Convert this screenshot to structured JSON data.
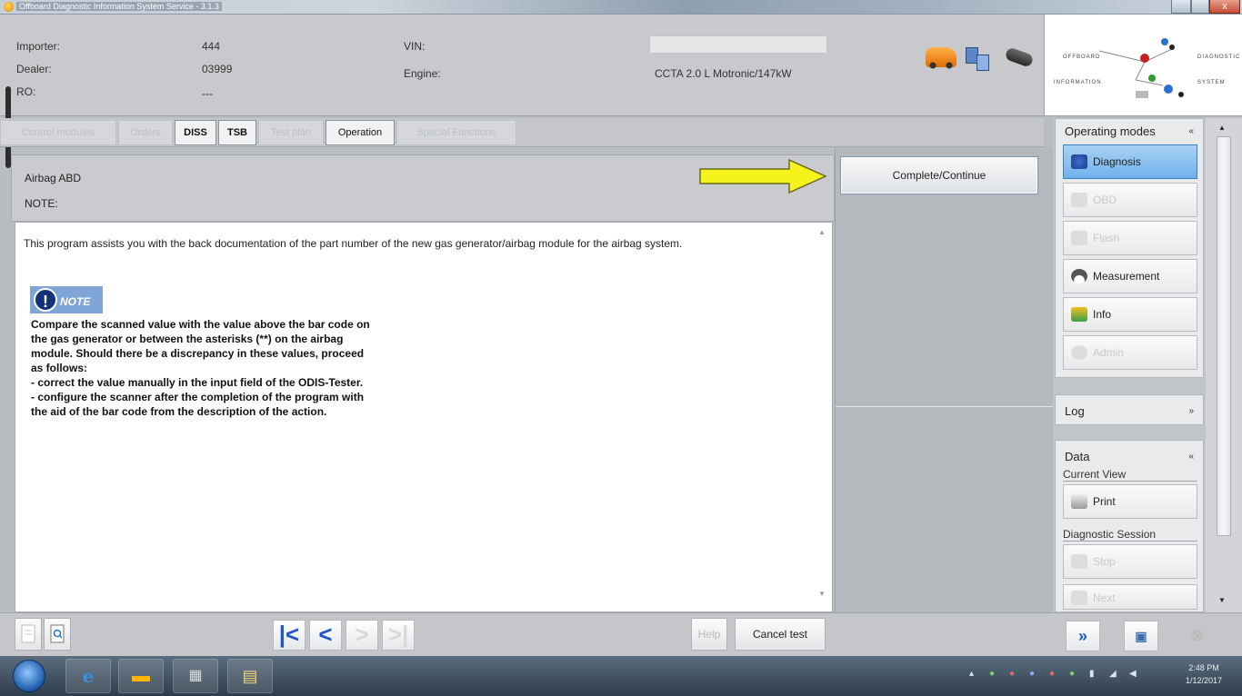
{
  "window": {
    "title": "Offboard Diagnostic Information System Service - 3.1.3",
    "close_glyph": "x"
  },
  "header": {
    "importer_label": "Importer:",
    "importer_value": "444",
    "dealer_label": "Dealer:",
    "dealer_value": "03999",
    "ro_label": "RO:",
    "ro_value": "---",
    "vin_label": "VIN:",
    "vin_value": "",
    "engine_label": "Engine:",
    "engine_value": "CCTA 2.0 L Motronic/147kW"
  },
  "logo": {
    "word1": "OFFBOARD",
    "word2": "DIAGNOSTIC",
    "word3": "INFORMATION",
    "word4": "SYSTEM"
  },
  "tabs": [
    {
      "label": "Control modules",
      "active": false
    },
    {
      "label": "Orders",
      "active": false
    },
    {
      "label": "DISS",
      "active": true
    },
    {
      "label": "TSB",
      "active": true
    },
    {
      "label": "Test plan",
      "active": false
    },
    {
      "label": "Operation",
      "active": true
    },
    {
      "label": "Special Functions",
      "active": false
    }
  ],
  "info_panel": {
    "title": "Airbag ABD",
    "note_label": "NOTE:"
  },
  "complete_button": "Complete/Continue",
  "document": {
    "intro": "This program assists you with the back documentation of the part number of the new gas generator/airbag module for the airbag system.",
    "note_badge": "NOTE",
    "note_lines": [
      "Compare the scanned value with the value above the bar code on",
      "the gas generator or between the asterisks (**) on the airbag",
      "module. Should there be a discrepancy in these values, proceed",
      "as follows:",
      "- correct the value manually in the input field of the ODIS-Tester.",
      "- configure the scanner after the completion of the program with",
      "the aid of the bar code from the description of the action."
    ]
  },
  "bottom_toolbar": {
    "help_label": "Help",
    "cancel_label": "Cancel test"
  },
  "right_panel": {
    "operating_modes": {
      "title": "Operating modes",
      "toggle": "«",
      "buttons": [
        {
          "label": "Diagnosis",
          "state": "active"
        },
        {
          "label": "OBD",
          "state": "disabled"
        },
        {
          "label": "Flash",
          "state": "disabled"
        },
        {
          "label": "Measurement",
          "state": "enabled"
        },
        {
          "label": "Info",
          "state": "enabled"
        },
        {
          "label": "Admin",
          "state": "disabled"
        }
      ]
    },
    "log": {
      "title": "Log",
      "toggle": "»"
    },
    "data": {
      "title": "Data",
      "toggle": "«",
      "current_view": "Current View",
      "print_label": "Print",
      "diagnostic_session": "Diagnostic Session",
      "stop_label": "Stop",
      "next_label": "Next"
    }
  },
  "taskbar": {
    "time": "2:48 PM",
    "date": "1/12/2017"
  },
  "colors": {
    "accent_blue": "#1f56c8",
    "arrow_yellow": "#f6f21b",
    "active_button": "#6fb1ea"
  }
}
